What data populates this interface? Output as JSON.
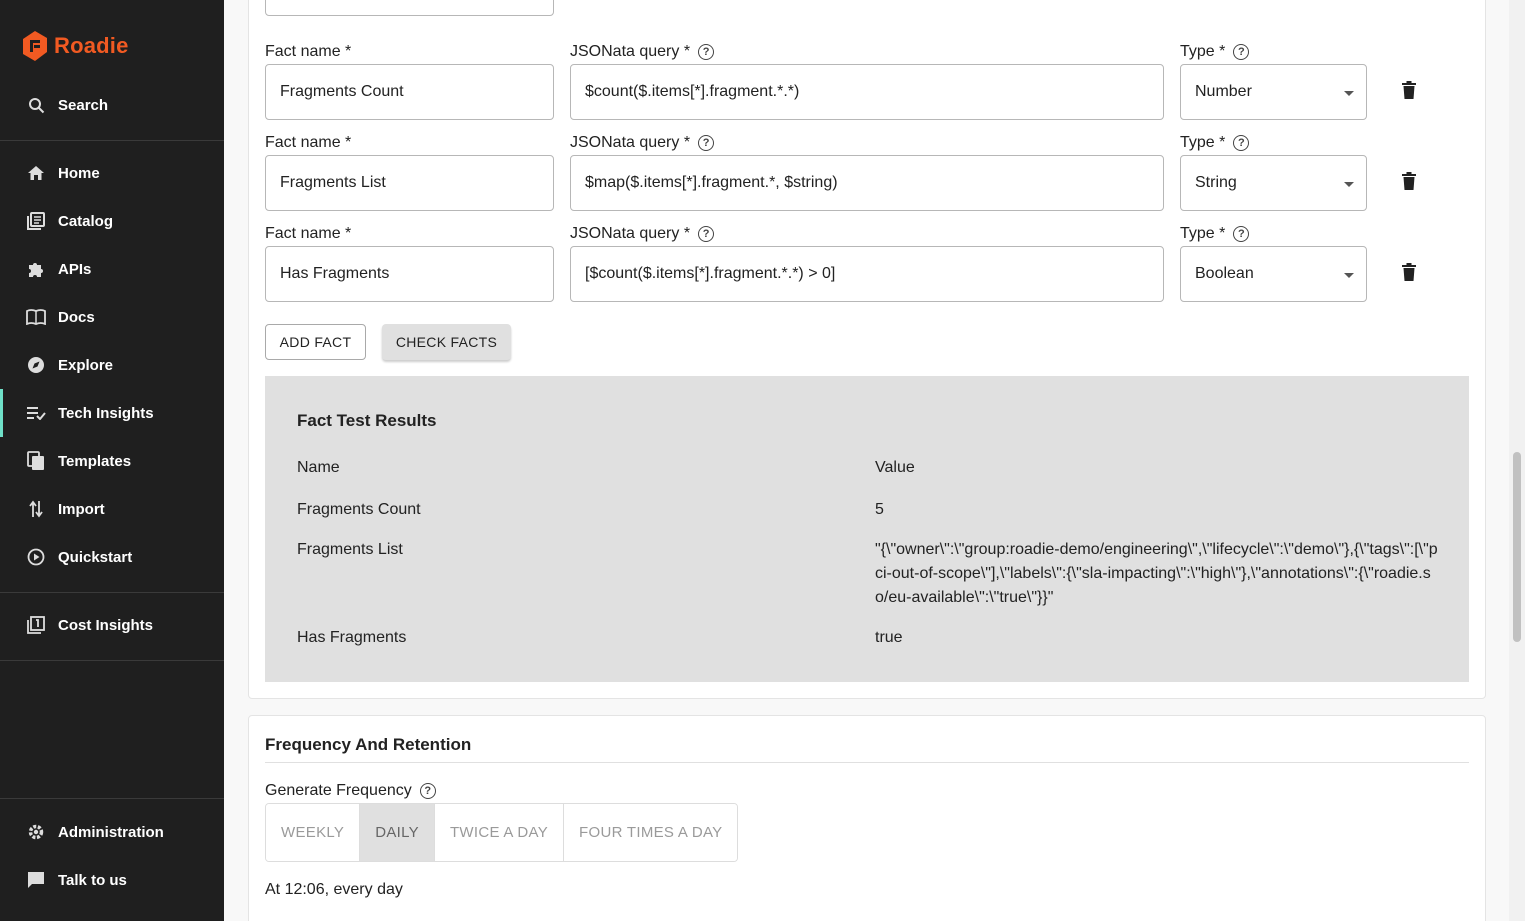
{
  "sidebar": {
    "logo": "Roadie",
    "search": "Search",
    "items": [
      {
        "label": "Home",
        "icon": "home-icon"
      },
      {
        "label": "Catalog",
        "icon": "catalog-icon"
      },
      {
        "label": "APIs",
        "icon": "puzzle-icon"
      },
      {
        "label": "Docs",
        "icon": "book-icon"
      },
      {
        "label": "Explore",
        "icon": "compass-icon"
      },
      {
        "label": "Tech Insights",
        "icon": "checklist-icon"
      },
      {
        "label": "Templates",
        "icon": "templates-icon"
      },
      {
        "label": "Import",
        "icon": "import-icon"
      },
      {
        "label": "Quickstart",
        "icon": "play-icon"
      }
    ],
    "cost_insights": "Cost Insights",
    "administration": "Administration",
    "talk_to_us": "Talk to us",
    "accent": "#6fe0c8",
    "brand": "#f15a22"
  },
  "facts": {
    "labels": {
      "fact_name": "Fact name *",
      "query": "JSONata query *",
      "type": "Type *"
    },
    "rows": [
      {
        "name": "Fragments Count",
        "query": "$count($.items[*].fragment.*.*)",
        "type": "Number"
      },
      {
        "name": "Fragments List",
        "query": "$map($.items[*].fragment.*, $string)",
        "type": "String"
      },
      {
        "name": "Has Fragments",
        "query": "[$count($.items[*].fragment.*.*) > 0]",
        "type": "Boolean"
      }
    ],
    "add_fact": "ADD FACT",
    "check_facts": "CHECK FACTS"
  },
  "results": {
    "title": "Fact Test Results",
    "col_name": "Name",
    "col_value": "Value",
    "rows": [
      {
        "name": "Fragments Count",
        "value": "5"
      },
      {
        "name": "Fragments List",
        "value": "\"{\\\"owner\\\":\\\"group:roadie-demo/engineering\\\",\\\"lifecycle\\\":\\\"demo\\\"},{\\\"tags\\\":[\\\"pci-out-of-scope\\\"],\\\"labels\\\":{\\\"sla-impacting\\\":\\\"high\\\"},\\\"annotations\\\":{\\\"roadie.so/eu-available\\\":\\\"true\\\"}}\""
      },
      {
        "name": "Has Fragments",
        "value": "true"
      }
    ]
  },
  "frequency": {
    "title": "Frequency And Retention",
    "generate_label": "Generate Frequency",
    "options": [
      "WEEKLY",
      "DAILY",
      "TWICE A DAY",
      "FOUR TIMES A DAY"
    ],
    "selected": "DAILY",
    "summary": "At 12:06, every day"
  }
}
